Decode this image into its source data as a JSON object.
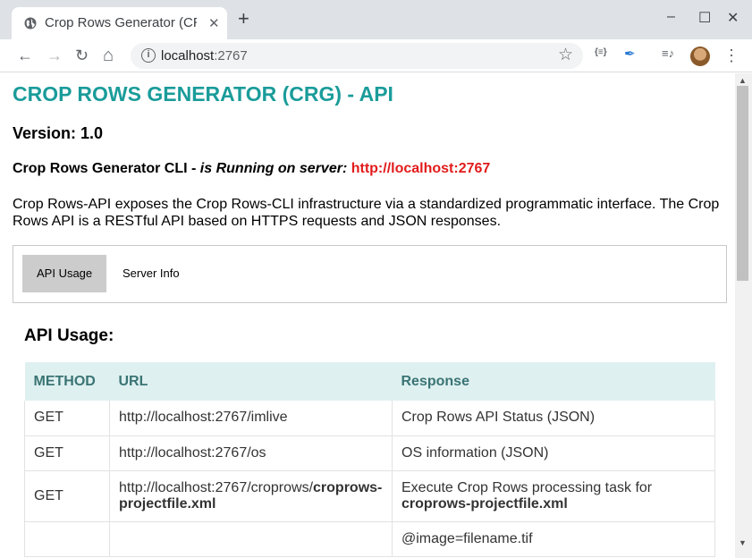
{
  "browser": {
    "tab_title": "Crop Rows Generator (CR",
    "tab_close": "✕",
    "new_tab": "+",
    "url_host": "localhost",
    "url_port": ":2767",
    "info_glyph": "i",
    "star_glyph": "☆",
    "back_glyph": "←",
    "forward_glyph": "→",
    "reload_glyph": "↻",
    "home_glyph": "⌂",
    "ext1": "{≡}",
    "ext2": "✒",
    "ext3": "≡♪",
    "menu_glyph": "⋮",
    "win_min": "–",
    "win_max": "☐",
    "win_close": "✕"
  },
  "page": {
    "title": "CROP ROWS GENERATOR (CRG) - API",
    "version": "Version: 1.0",
    "cli_prefix": "Crop Rows Generator CLI - ",
    "cli_running": "is Running on server:",
    "cli_url": "http://localhost:2767",
    "description": "Crop Rows-API exposes the Crop Rows-CLI infrastructure via a standardized programmatic interface. The Crop Rows API is a RESTful API based on HTTPS requests and JSON responses.",
    "tabs": [
      {
        "label": "API Usage"
      },
      {
        "label": "Server Info"
      }
    ],
    "usage_title": "API Usage:",
    "table": {
      "headers": [
        "METHOD",
        "URL",
        "Response"
      ],
      "rows": [
        {
          "method": "GET",
          "url": "http://localhost:2767/imlive",
          "response": "Crop Rows API Status (JSON)"
        },
        {
          "method": "GET",
          "url": "http://localhost:2767/os",
          "response": "OS information (JSON)"
        },
        {
          "method": "GET",
          "url_prefix": "http://localhost:2767/croprows/",
          "url_bold": "croprows-projectfile.xml",
          "response_prefix": "Execute Crop Rows processing task for",
          "response_bold": "croprows-projectfile.xml"
        },
        {
          "method": "",
          "url": "",
          "response": "@image=filename.tif"
        }
      ]
    }
  },
  "colors": {
    "title": "#1a9c9a",
    "server_url": "#e21b1b",
    "table_header_bg": "#dff0f0",
    "table_header_text": "#3a7474",
    "active_tab_bg": "#cccccc"
  }
}
